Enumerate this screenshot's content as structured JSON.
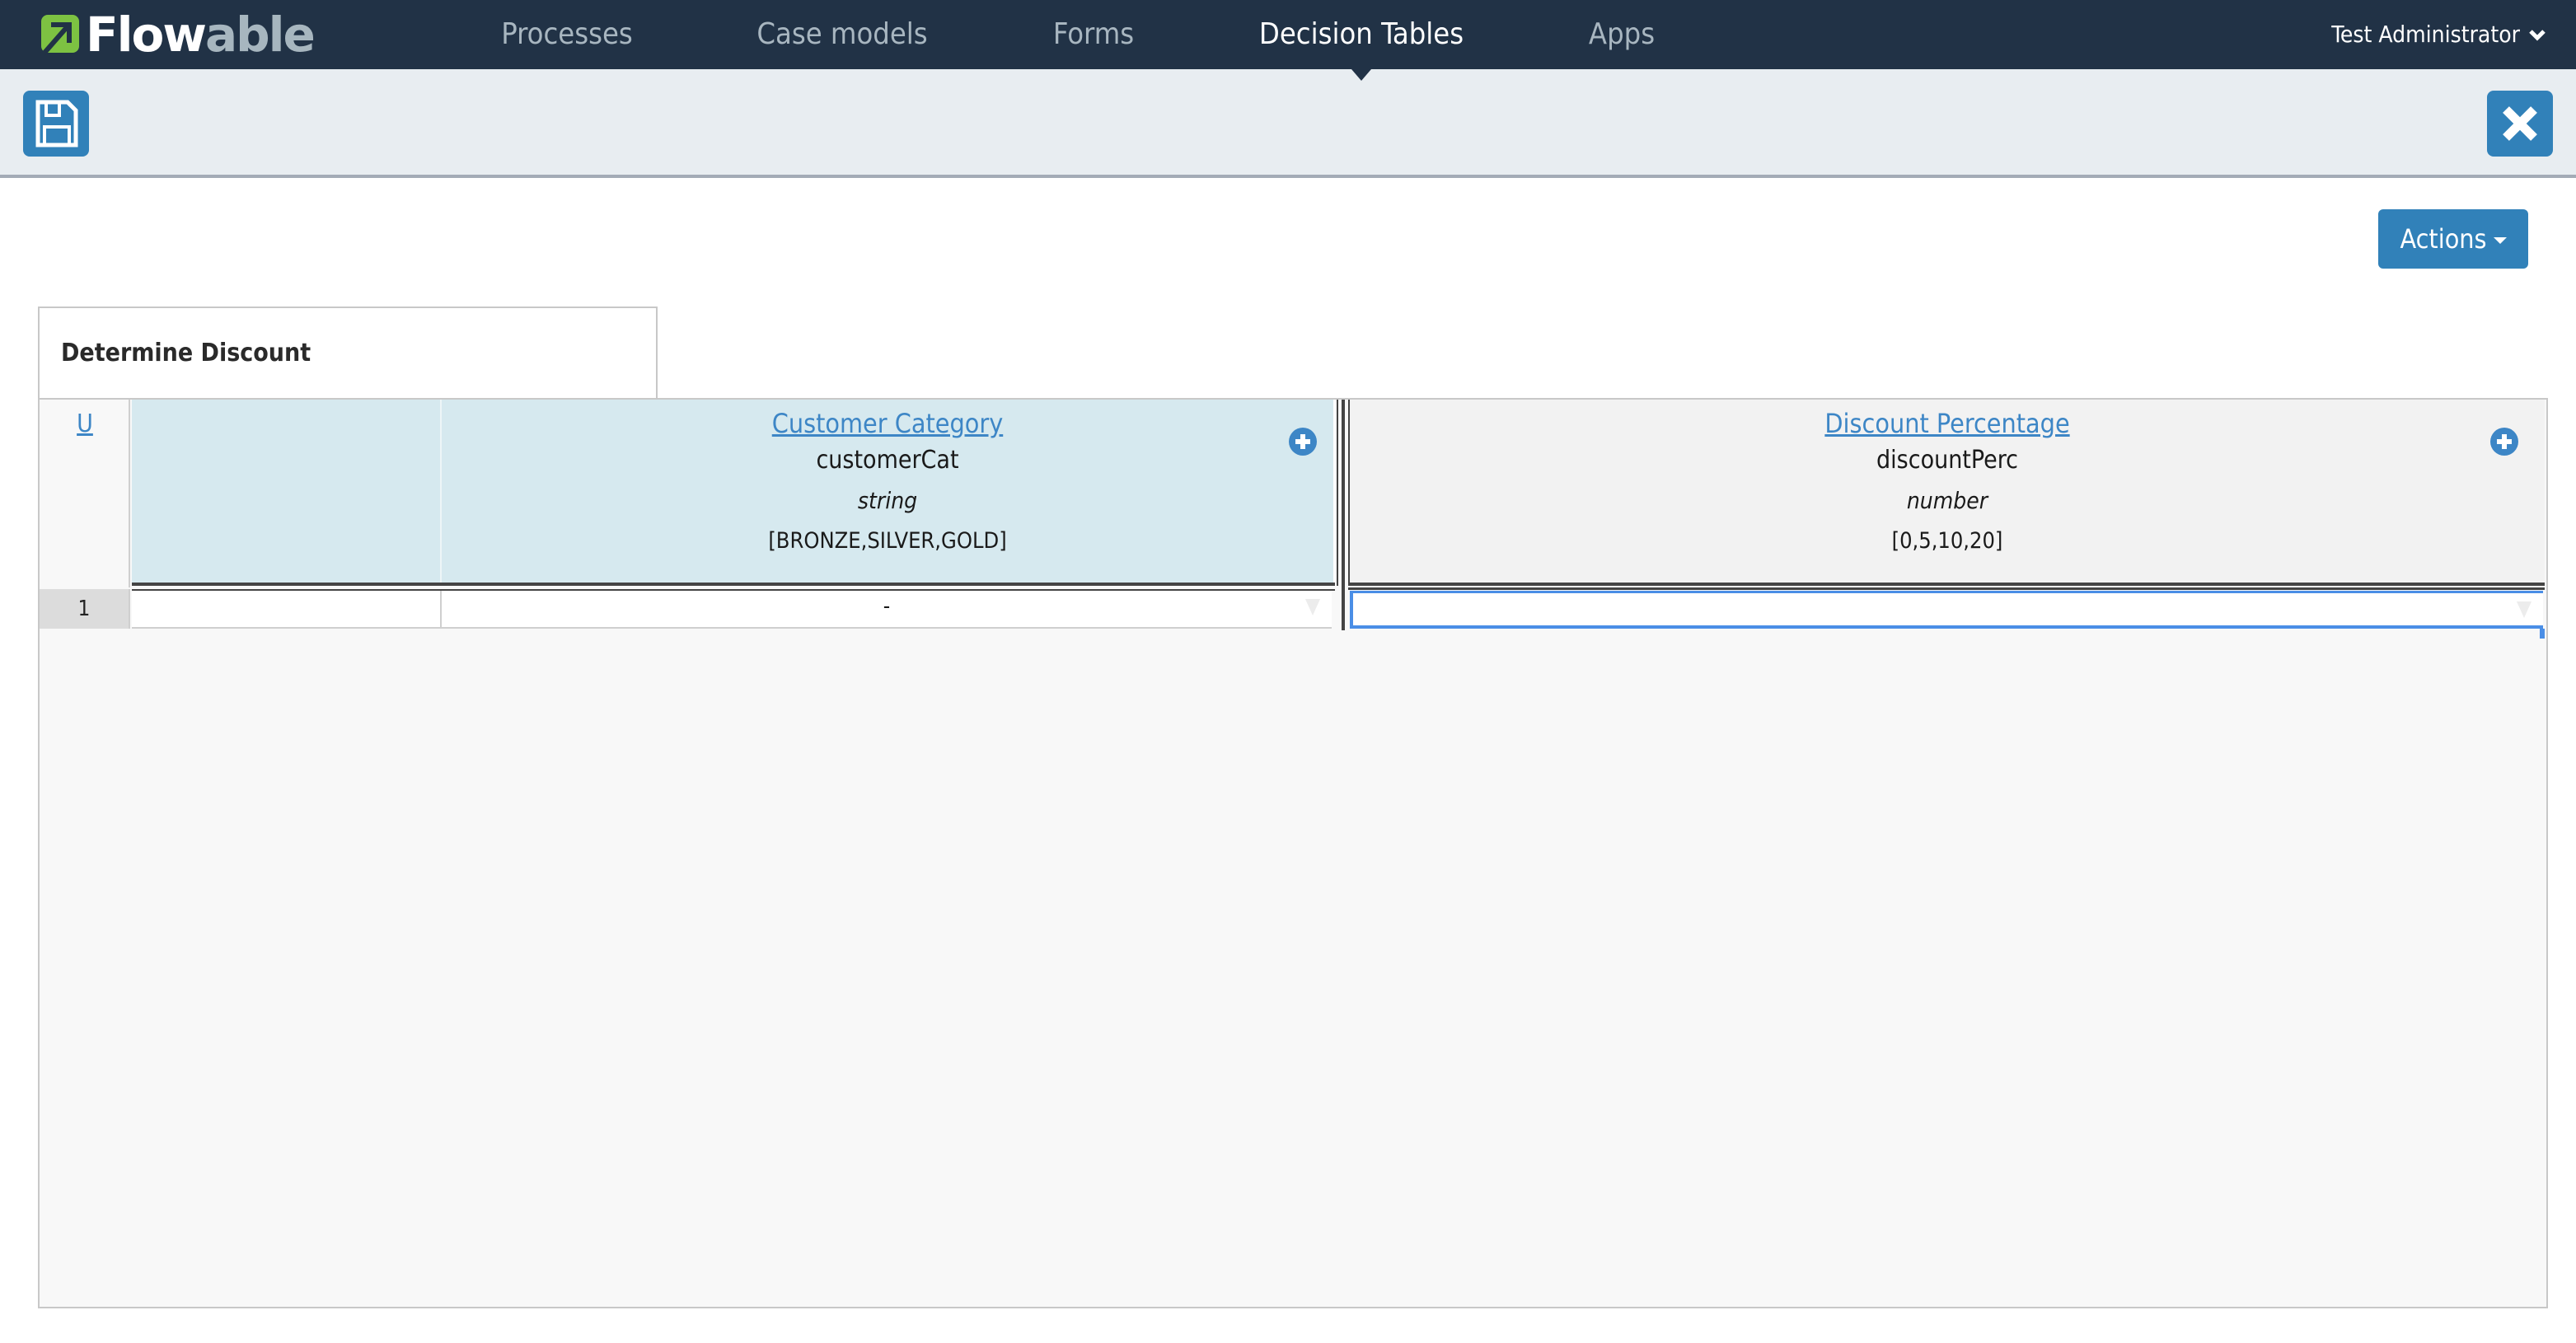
{
  "navbar": {
    "brand": {
      "part1": "Flow",
      "part2": "able",
      "icon": "flowable-logo-icon"
    },
    "items": [
      {
        "label": "Processes",
        "active": false
      },
      {
        "label": "Case models",
        "active": false
      },
      {
        "label": "Forms",
        "active": false
      },
      {
        "label": "Decision Tables",
        "active": true
      },
      {
        "label": "Apps",
        "active": false
      }
    ],
    "user": {
      "name": "Test Administrator",
      "icon": "chevron-down-icon"
    }
  },
  "toolbar": {
    "save_icon": "floppy-disk-icon",
    "close_icon": "close-icon"
  },
  "actions": {
    "label": "Actions",
    "icon": "caret-down-icon"
  },
  "decision_table": {
    "name": "Determine Discount",
    "hit_policy": "U",
    "input_columns": [
      {
        "label": "Customer Category",
        "variable": "customerCat",
        "type": "string",
        "values": "[BRONZE,SILVER,GOLD]"
      }
    ],
    "output_columns": [
      {
        "label": "Discount Percentage",
        "variable": "discountPerc",
        "type": "number",
        "values": "[0,5,10,20]"
      }
    ],
    "rows": [
      {
        "number": "1",
        "input_operator": "",
        "input_value": "-",
        "output_value": ""
      }
    ]
  },
  "colors": {
    "navbar_bg": "#213246",
    "toolbar_bg": "#e8edf1",
    "primary": "#3181b9",
    "input_header_bg": "#d6e9ef",
    "output_header_bg": "#f2f2f2",
    "link": "#3d86c6",
    "selection": "#4a8ee6",
    "brand_green": "#7dc242"
  }
}
